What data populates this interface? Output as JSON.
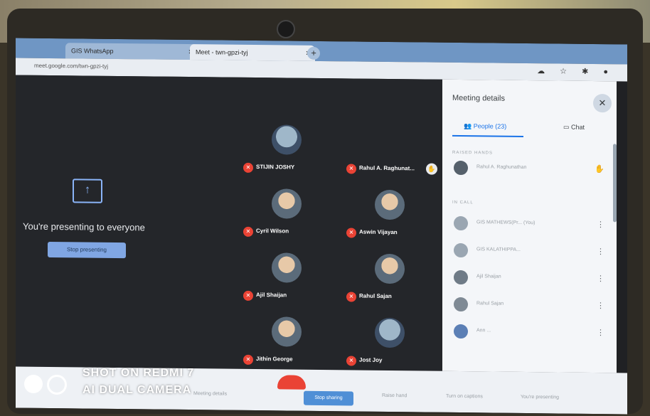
{
  "browser": {
    "tabs": [
      {
        "label": "GIS WhatsApp",
        "active": false
      },
      {
        "label": "Meet - twn-gpzi-tyj",
        "active": true
      }
    ],
    "url": "meet.google.com/twn-gpzi-tyj"
  },
  "presenting": {
    "message": "You're presenting to everyone",
    "stop_button": "Stop presenting"
  },
  "participants": [
    {
      "name": "STIJIN JOSHY"
    },
    {
      "name": "Rahul A. Raghunat..."
    },
    {
      "name": "Cyril Wilson"
    },
    {
      "name": "Aswin Vijayan"
    },
    {
      "name": "Ajil Shaijan"
    },
    {
      "name": "Rahul Sajan"
    },
    {
      "name": "Jithin George"
    },
    {
      "name": "Jost Joy"
    }
  ],
  "panel": {
    "title": "Meeting details",
    "tab_people": "People (23)",
    "tab_chat": "Chat",
    "section_raised": "RAISED HANDS",
    "raised_person": "Rahul A. Raghunathan",
    "section_in_call": "IN CALL",
    "in_call": [
      {
        "name": "GIS MATHEWS(Pr... (You)"
      },
      {
        "name": "GIS KALATHIPPA..."
      },
      {
        "name": "Ajil Shaijan"
      },
      {
        "name": "Rahul Sajan"
      },
      {
        "name": "Ann ..."
      }
    ]
  },
  "toolbar": {
    "meeting_details": "Meeting details",
    "stop_button": "Stop sharing",
    "raise_hand": "Raise hand",
    "captions": "Turn on captions",
    "present": "You're presenting"
  },
  "watermark": {
    "line1": "SHOT ON REDMI 7",
    "line2": "AI DUAL CAMERA"
  },
  "colors": {
    "accent": "#8ab4f8",
    "danger": "#ea4335",
    "meet_bg": "#202124",
    "panel_bg": "#f4f6f9"
  },
  "icons": [
    "present-screen-icon",
    "mic-off-icon",
    "people-icon",
    "chat-icon",
    "close-icon",
    "raised-hand-icon",
    "pin-icon"
  ]
}
